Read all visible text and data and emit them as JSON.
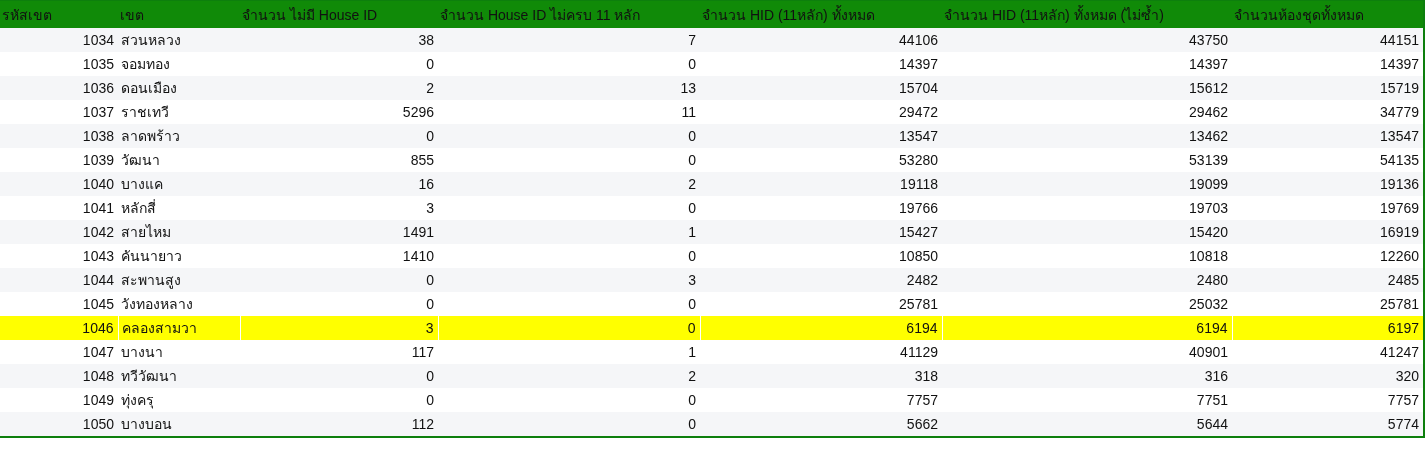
{
  "table": {
    "columns": [
      "รหัสเขต",
      "เขต",
      "จำนวน ไม่มี House ID",
      "จำนวน House ID ไม่ครบ 11 หลัก",
      "จำนวน HID (11หลัก) ทั้งหมด",
      "จำนวน HID (11หลัก) ทั้งหมด (ไม่ซ้ำ)",
      "จำนวนห้องชุดทั้งหมด"
    ],
    "rows": [
      {
        "cells": [
          "1034",
          "สวนหลวง",
          "38",
          "7",
          "44106",
          "43750",
          "44151"
        ],
        "highlighted": false
      },
      {
        "cells": [
          "1035",
          "จอมทอง",
          "0",
          "0",
          "14397",
          "14397",
          "14397"
        ],
        "highlighted": false
      },
      {
        "cells": [
          "1036",
          "ดอนเมือง",
          "2",
          "13",
          "15704",
          "15612",
          "15719"
        ],
        "highlighted": false
      },
      {
        "cells": [
          "1037",
          "ราชเทวี",
          "5296",
          "11",
          "29472",
          "29462",
          "34779"
        ],
        "highlighted": false
      },
      {
        "cells": [
          "1038",
          "ลาดพร้าว",
          "0",
          "0",
          "13547",
          "13462",
          "13547"
        ],
        "highlighted": false
      },
      {
        "cells": [
          "1039",
          "วัฒนา",
          "855",
          "0",
          "53280",
          "53139",
          "54135"
        ],
        "highlighted": false
      },
      {
        "cells": [
          "1040",
          "บางแค",
          "16",
          "2",
          "19118",
          "19099",
          "19136"
        ],
        "highlighted": false
      },
      {
        "cells": [
          "1041",
          "หลักสี่",
          "3",
          "0",
          "19766",
          "19703",
          "19769"
        ],
        "highlighted": false
      },
      {
        "cells": [
          "1042",
          "สายไหม",
          "1491",
          "1",
          "15427",
          "15420",
          "16919"
        ],
        "highlighted": false
      },
      {
        "cells": [
          "1043",
          "คันนายาว",
          "1410",
          "0",
          "10850",
          "10818",
          "12260"
        ],
        "highlighted": false
      },
      {
        "cells": [
          "1044",
          "สะพานสูง",
          "0",
          "3",
          "2482",
          "2480",
          "2485"
        ],
        "highlighted": false
      },
      {
        "cells": [
          "1045",
          "วังทองหลาง",
          "0",
          "0",
          "25781",
          "25032",
          "25781"
        ],
        "highlighted": false
      },
      {
        "cells": [
          "1046",
          "คลองสามวา",
          "3",
          "0",
          "6194",
          "6194",
          "6197"
        ],
        "highlighted": true
      },
      {
        "cells": [
          "1047",
          "บางนา",
          "117",
          "1",
          "41129",
          "40901",
          "41247"
        ],
        "highlighted": false
      },
      {
        "cells": [
          "1048",
          "ทวีวัฒนา",
          "0",
          "2",
          "318",
          "316",
          "320"
        ],
        "highlighted": false
      },
      {
        "cells": [
          "1049",
          "ทุ่งครุ",
          "0",
          "0",
          "7757",
          "7751",
          "7757"
        ],
        "highlighted": false
      },
      {
        "cells": [
          "1050",
          "บางบอน",
          "112",
          "0",
          "5662",
          "5644",
          "5774"
        ],
        "highlighted": false
      }
    ]
  }
}
